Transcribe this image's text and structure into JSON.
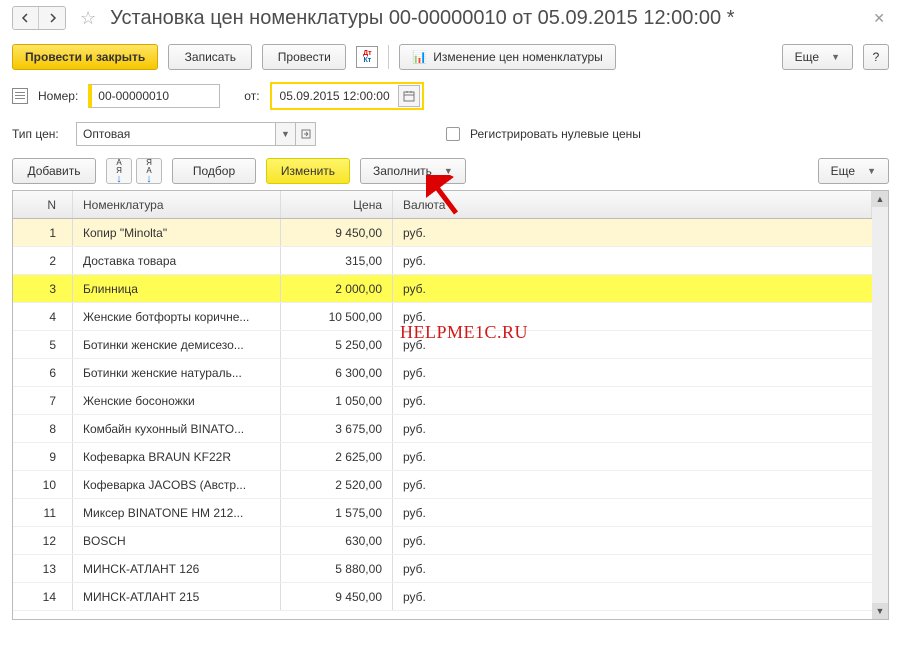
{
  "title": "Установка цен номенклатуры 00-00000010 от 05.09.2015 12:00:00 *",
  "toolbar": {
    "post_close": "Провести и закрыть",
    "save": "Записать",
    "post": "Провести",
    "change_report": "Изменение цен номенклатуры",
    "more": "Еще",
    "help": "?"
  },
  "fields": {
    "number_label": "Номер:",
    "number_value": "00-00000010",
    "from_label": "от:",
    "date_value": "05.09.2015 12:00:00",
    "price_type_label": "Тип цен:",
    "price_type_value": "Оптовая",
    "register_zero_label": "Регистрировать нулевые цены"
  },
  "table_toolbar": {
    "add": "Добавить",
    "pick": "Подбор",
    "change": "Изменить",
    "fill": "Заполнить",
    "more": "Еще"
  },
  "table": {
    "headers": {
      "n": "N",
      "name": "Номенклатура",
      "price": "Цена",
      "currency": "Валюта"
    },
    "rows": [
      {
        "n": 1,
        "name": "Копир \"Minolta\"",
        "price": "9 450,00",
        "currency": "руб.",
        "state": "sel"
      },
      {
        "n": 2,
        "name": "Доставка товара",
        "price": "315,00",
        "currency": "руб."
      },
      {
        "n": 3,
        "name": "Блинница",
        "price": "2 000,00",
        "currency": "руб.",
        "state": "hl"
      },
      {
        "n": 4,
        "name": "Женские ботфорты коричне...",
        "price": "10 500,00",
        "currency": "руб."
      },
      {
        "n": 5,
        "name": "Ботинки женские демисезо...",
        "price": "5 250,00",
        "currency": "руб."
      },
      {
        "n": 6,
        "name": "Ботинки женские натураль...",
        "price": "6 300,00",
        "currency": "руб."
      },
      {
        "n": 7,
        "name": "Женские босоножки",
        "price": "1 050,00",
        "currency": "руб."
      },
      {
        "n": 8,
        "name": "Комбайн кухонный BINATO...",
        "price": "3 675,00",
        "currency": "руб."
      },
      {
        "n": 9,
        "name": "Кофеварка BRAUN KF22R",
        "price": "2 625,00",
        "currency": "руб."
      },
      {
        "n": 10,
        "name": "Кофеварка JACOBS (Австр...",
        "price": "2 520,00",
        "currency": "руб."
      },
      {
        "n": 11,
        "name": "Миксер BINATONE HM 212...",
        "price": "1 575,00",
        "currency": "руб."
      },
      {
        "n": 12,
        "name": "BOSCH",
        "price": "630,00",
        "currency": "руб."
      },
      {
        "n": 13,
        "name": "МИНСК-АТЛАНТ 126",
        "price": "5 880,00",
        "currency": "руб."
      },
      {
        "n": 14,
        "name": "МИНСК-АТЛАНТ 215",
        "price": "9 450,00",
        "currency": "руб."
      }
    ]
  },
  "watermark": "HELPME1C.RU",
  "icons": {
    "chart_bar": "📊"
  }
}
